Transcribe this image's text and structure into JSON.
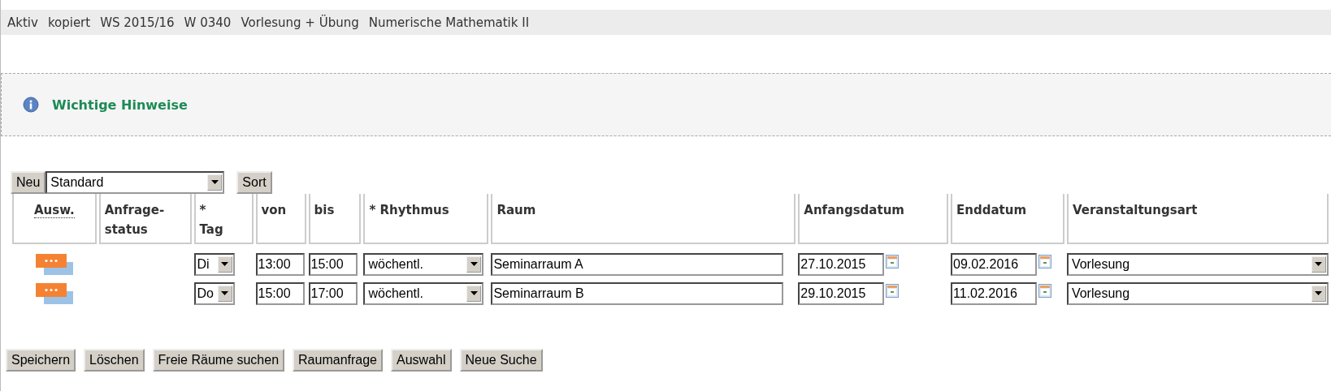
{
  "header": {
    "items": [
      "Aktiv",
      "kopiert",
      "WS 2015/16",
      "W 0340",
      "Vorlesung + Übung",
      "Numerische Mathematik II"
    ]
  },
  "notice": {
    "title": "Wichtige Hinweise"
  },
  "toolbar": {
    "new_button": "Neu",
    "view_select": "Standard",
    "sort_button": "Sort"
  },
  "table": {
    "columns": [
      {
        "label": "Ausw.",
        "kind": "abbr"
      },
      {
        "label": "Anfrage-status",
        "kind": "plain"
      },
      {
        "label": "* Tag",
        "kind": "plain"
      },
      {
        "label": "von",
        "kind": "plain"
      },
      {
        "label": "bis",
        "kind": "plain"
      },
      {
        "label": "* Rhythmus",
        "kind": "plain"
      },
      {
        "label": "Raum",
        "kind": "plain"
      },
      {
        "label": "Anfangsdatum",
        "kind": "plain"
      },
      {
        "label": "Enddatum",
        "kind": "plain"
      },
      {
        "label": "Veranstaltungsart",
        "kind": "plain"
      }
    ],
    "rows": [
      {
        "tag": "Di",
        "von": "13:00",
        "bis": "15:00",
        "rhythmus": "wöchentl.",
        "raum": "Seminarraum A",
        "anfangsdatum": "27.10.2015",
        "enddatum": "09.02.2016",
        "veranstaltungsart": "Vorlesung"
      },
      {
        "tag": "Do",
        "von": "15:00",
        "bis": "17:00",
        "rhythmus": "wöchentl.",
        "raum": "Seminarraum B",
        "anfangsdatum": "29.10.2015",
        "enddatum": "11.02.2016",
        "veranstaltungsart": "Vorlesung"
      }
    ]
  },
  "buttons": [
    "Speichern",
    "Löschen",
    "Freie Räume suchen",
    "Raumanfrage",
    "Auswahl",
    "Neue Suche"
  ]
}
